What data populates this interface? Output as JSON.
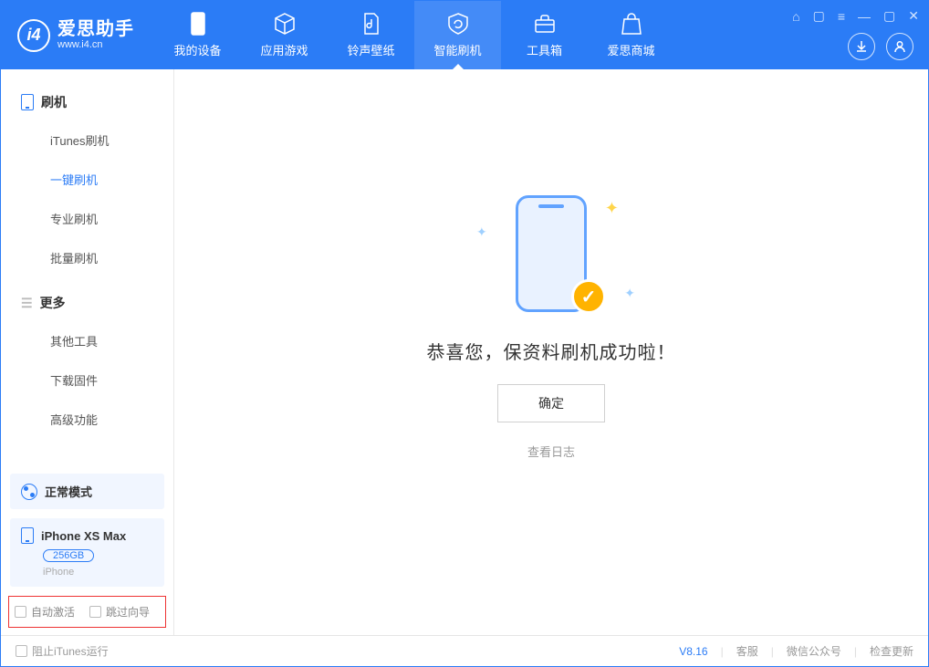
{
  "app": {
    "title": "爱思助手",
    "subtitle": "www.i4.cn"
  },
  "nav": {
    "tabs": [
      {
        "label": "我的设备"
      },
      {
        "label": "应用游戏"
      },
      {
        "label": "铃声壁纸"
      },
      {
        "label": "智能刷机"
      },
      {
        "label": "工具箱"
      },
      {
        "label": "爱思商城"
      }
    ]
  },
  "sidebar": {
    "group_flash": {
      "title": "刷机",
      "items": [
        "iTunes刷机",
        "一键刷机",
        "专业刷机",
        "批量刷机"
      ]
    },
    "group_more": {
      "title": "更多",
      "items": [
        "其他工具",
        "下载固件",
        "高级功能"
      ]
    },
    "mode_label": "正常模式",
    "device": {
      "name": "iPhone XS Max",
      "capacity": "256GB",
      "type": "iPhone"
    },
    "checkboxes": {
      "auto_activate": "自动激活",
      "skip_guide": "跳过向导"
    }
  },
  "main": {
    "success_text": "恭喜您，保资料刷机成功啦！",
    "confirm_label": "确定",
    "view_log_label": "查看日志"
  },
  "footer": {
    "block_itunes": "阻止iTunes运行",
    "version": "V8.16",
    "links": [
      "客服",
      "微信公众号",
      "检查更新"
    ]
  }
}
